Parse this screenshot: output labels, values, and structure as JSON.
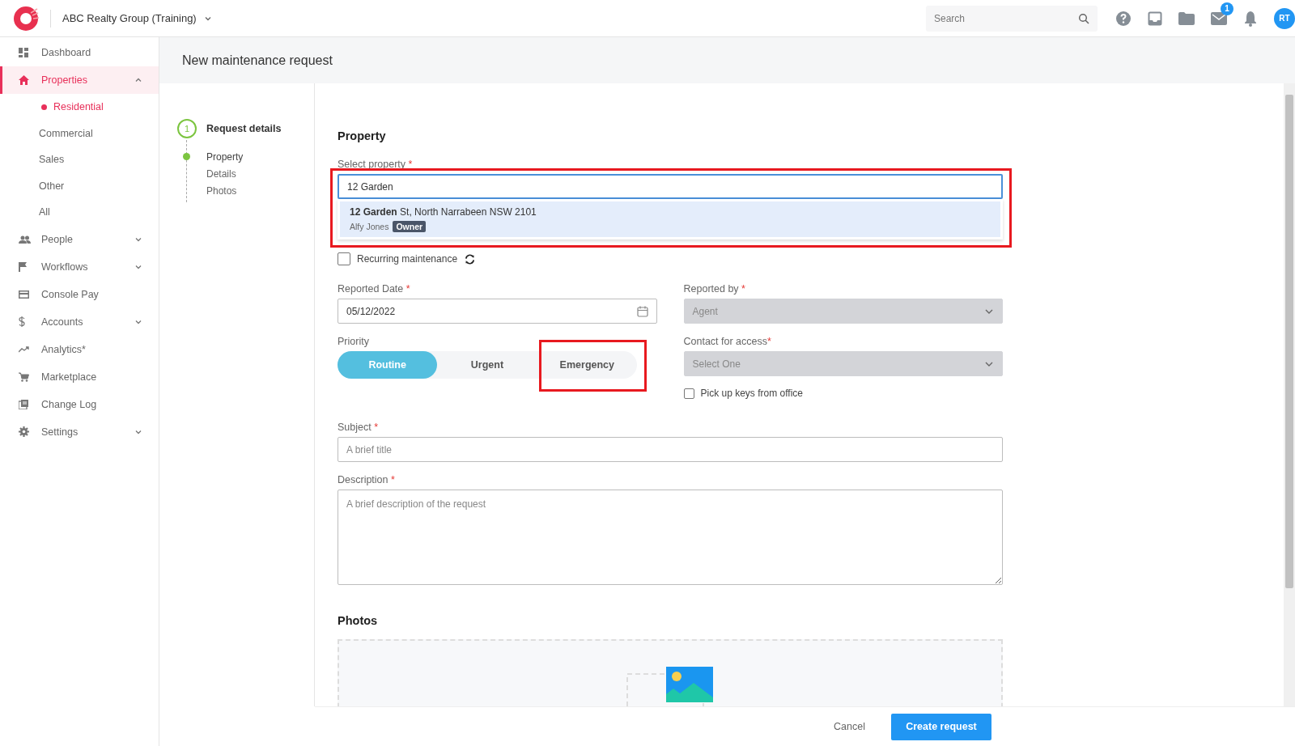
{
  "top_bar": {
    "org_name": "ABC Realty Group (Training)",
    "search": {
      "placeholder": "Search"
    },
    "mail_badge": "1",
    "avatar": "RT"
  },
  "sidebar": {
    "items": [
      {
        "label": "Dashboard",
        "kind": "link",
        "selected": false
      },
      {
        "label": "Properties",
        "kind": "group",
        "selected": true,
        "expanded": true,
        "children": [
          {
            "label": "Residential",
            "selected": true
          },
          {
            "label": "Commercial",
            "selected": false
          },
          {
            "label": "Sales",
            "selected": false
          },
          {
            "label": "Other",
            "selected": false
          },
          {
            "label": "All",
            "selected": false
          }
        ]
      },
      {
        "label": "People",
        "kind": "group",
        "selected": false,
        "expanded": false
      },
      {
        "label": "Workflows",
        "kind": "group",
        "selected": false,
        "expanded": false
      },
      {
        "label": "Console Pay",
        "kind": "link",
        "selected": false
      },
      {
        "label": "Accounts",
        "kind": "group",
        "selected": false,
        "expanded": false
      },
      {
        "label": "Analytics*",
        "kind": "link",
        "selected": false
      },
      {
        "label": "Marketplace",
        "kind": "link",
        "selected": false
      },
      {
        "label": "Change Log",
        "kind": "link",
        "selected": false
      },
      {
        "label": "Settings",
        "kind": "group",
        "selected": false,
        "expanded": false
      }
    ]
  },
  "page": {
    "title": "New maintenance request"
  },
  "stepper": {
    "step_number": "1",
    "title": "Request details",
    "substeps": [
      {
        "label": "Property",
        "selected": true
      },
      {
        "label": "Details",
        "selected": false
      },
      {
        "label": "Photos",
        "selected": false
      }
    ]
  },
  "form": {
    "section_title": "Property",
    "select_property": {
      "label": "Select property",
      "required_mark": "*",
      "value": "12 Garden",
      "highlighted": true,
      "suggestions": [
        {
          "address": "**12 Garden** St, North Narrabeen NSW 2101",
          "name": "Alfy Jones",
          "role": "Owner",
          "selected": true
        }
      ]
    },
    "recurring": {
      "label": "Recurring maintenance",
      "checked": false
    },
    "reported_date": {
      "label": "Reported Date",
      "required_mark": "*",
      "value": "05/12/2022"
    },
    "reported_by": {
      "label": "Reported by",
      "required_mark": "*",
      "value": "Agent",
      "disabled": true
    },
    "priority": {
      "label": "Priority",
      "options": [
        {
          "label": "Routine",
          "selected": true,
          "highlighted": false
        },
        {
          "label": "Urgent",
          "selected": false,
          "highlighted": false
        },
        {
          "label": "Emergency",
          "selected": false,
          "highlighted": true
        }
      ]
    },
    "contact_for_access": {
      "label": "Contact for access",
      "required_mark": "*",
      "placeholder": "Select One",
      "disabled": true
    },
    "pick_up_keys": {
      "label": "Pick up keys from office",
      "checked": false
    },
    "subject": {
      "label": "Subject",
      "required_mark": "*",
      "placeholder": "A brief title"
    },
    "description": {
      "label": "Description",
      "required_mark": "*",
      "placeholder": "A brief description of the request"
    },
    "photos": {
      "title": "Photos"
    }
  },
  "footer": {
    "buttons": [
      {
        "label": "Cancel",
        "kind": "secondary"
      },
      {
        "label": "Create request",
        "kind": "primary"
      }
    ]
  }
}
